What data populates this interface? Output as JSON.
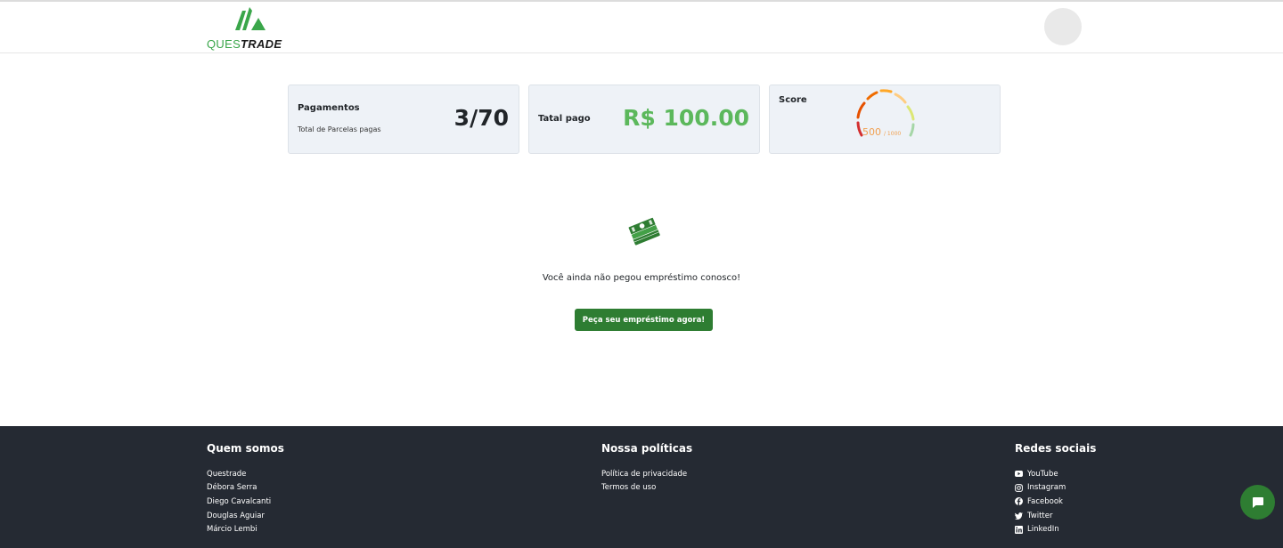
{
  "brand": {
    "name_part1": "QUES",
    "name_part2": "TRADE",
    "color": "#3aa64a"
  },
  "header": {
    "avatar_icon": "user-avatar"
  },
  "cards": {
    "payments": {
      "title": "Pagamentos",
      "subtitle": "Total de Parcelas pagas",
      "value": "3/70"
    },
    "total_paid": {
      "title": "Tatal pago",
      "value": "R$ 100.00",
      "color": "#5cb85c"
    },
    "score": {
      "title": "Score",
      "value": "500",
      "max": "/ 1000",
      "level": 0.5
    }
  },
  "empty_state": {
    "icon": "money-icon",
    "message": "Você ainda não pegou empréstimo conosco!",
    "cta_label": "Peça seu empréstimo agora!"
  },
  "footer": {
    "about": {
      "title": "Quem somos",
      "items": [
        "Questrade",
        "Débora Serra",
        "Diego Cavalcanti",
        "Douglas Aguiar",
        "Márcio Lembi"
      ]
    },
    "policies": {
      "title": "Nossa políticas",
      "items": [
        "Política de privacidade",
        "Termos de uso"
      ]
    },
    "social": {
      "title": "Redes sociais",
      "items": [
        {
          "label": "YouTube",
          "icon": "youtube-icon"
        },
        {
          "label": "Instagram",
          "icon": "instagram-icon"
        },
        {
          "label": "Facebook",
          "icon": "facebook-icon"
        },
        {
          "label": "Twitter",
          "icon": "twitter-icon"
        },
        {
          "label": "LinkedIn",
          "icon": "linkedin-icon"
        }
      ]
    }
  },
  "chat": {
    "icon": "chat-icon",
    "color": "#2e7d32"
  }
}
